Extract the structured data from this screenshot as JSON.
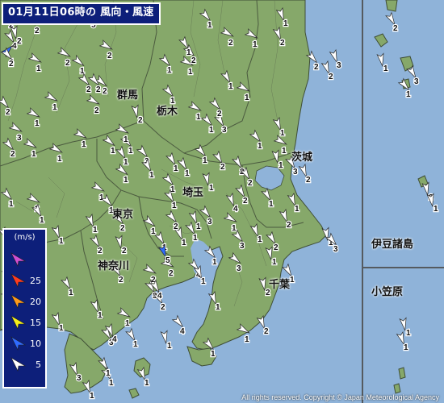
{
  "title": "01月11日06時の 風向・風速",
  "legend": {
    "unit": "(m/s)",
    "entries": [
      {
        "label": "",
        "color": "#d14dd1"
      },
      {
        "label": "25",
        "color": "#ff3b1f"
      },
      {
        "label": "20",
        "color": "#ff9a1a"
      },
      {
        "label": "15",
        "color": "#f5f01a"
      },
      {
        "label": "10",
        "color": "#2f6bff"
      },
      {
        "label": "5",
        "color": "#ffffff"
      }
    ]
  },
  "prefectures": [
    {
      "label": "群馬"
    },
    {
      "label": "栃木"
    },
    {
      "label": "茨城"
    },
    {
      "label": "埼玉"
    },
    {
      "label": "東京"
    },
    {
      "label": "神奈川"
    },
    {
      "label": "千葉"
    },
    {
      "label": "伊豆諸島"
    },
    {
      "label": "小笠原"
    }
  ],
  "copyright": "All rights reserved. Copyright © Japan Meteorological Agency",
  "colors": {
    "sea": "#8fb3d9",
    "land": "#86a86a",
    "boundary": "#4b5a3f",
    "panel": "#0d1f7a"
  },
  "stations": [
    {
      "speed": 2,
      "dir": 200,
      "color": "white"
    },
    {
      "speed": 2,
      "dir": 190,
      "color": "white"
    },
    {
      "speed": 4,
      "dir": 330,
      "color": "white"
    },
    {
      "speed": 4,
      "dir": 225,
      "color": "blue"
    },
    {
      "speed": 1,
      "dir": 300,
      "color": "white"
    },
    {
      "speed": 2,
      "dir": 300,
      "color": "white"
    },
    {
      "speed": 1,
      "dir": 310,
      "color": "white"
    },
    {
      "speed": 2,
      "dir": 300,
      "color": "white"
    },
    {
      "speed": 2,
      "dir": 320,
      "color": "white"
    },
    {
      "speed": 2,
      "dir": 310,
      "color": "white"
    },
    {
      "speed": 1,
      "dir": 300,
      "color": "white"
    },
    {
      "speed": 2,
      "dir": 320,
      "color": "white"
    },
    {
      "speed": 1,
      "dir": 300,
      "color": "white"
    },
    {
      "speed": 2,
      "dir": 300,
      "color": "white"
    },
    {
      "speed": 1,
      "dir": 300,
      "color": "white"
    },
    {
      "speed": 2,
      "dir": 320,
      "color": "white"
    },
    {
      "speed": 3,
      "dir": 300,
      "color": "white"
    },
    {
      "speed": 1,
      "dir": 300,
      "color": "white"
    },
    {
      "speed": 1,
      "dir": 310,
      "color": "white"
    },
    {
      "speed": 1,
      "dir": 320,
      "color": "white"
    },
    {
      "speed": 1,
      "dir": 300,
      "color": "white"
    },
    {
      "speed": 3,
      "dir": 320,
      "color": "white"
    },
    {
      "speed": 1,
      "dir": 300,
      "color": "white"
    },
    {
      "speed": 2,
      "dir": 320,
      "color": "white"
    },
    {
      "speed": 1,
      "dir": 300,
      "color": "white"
    },
    {
      "speed": 1,
      "dir": 320,
      "color": "white"
    },
    {
      "speed": 1,
      "dir": 300,
      "color": "white"
    },
    {
      "speed": 1,
      "dir": 320,
      "color": "white"
    },
    {
      "speed": 2,
      "dir": 320,
      "color": "white"
    },
    {
      "speed": 2,
      "dir": 300,
      "color": "white"
    },
    {
      "speed": 1,
      "dir": 300,
      "color": "white"
    },
    {
      "speed": 1,
      "dir": 330,
      "color": "white"
    },
    {
      "speed": 3,
      "dir": 330,
      "color": "white"
    },
    {
      "speed": 2,
      "dir": 330,
      "color": "white"
    },
    {
      "speed": 1,
      "dir": 320,
      "color": "white"
    },
    {
      "speed": 1,
      "dir": 340,
      "color": "white"
    },
    {
      "speed": 2,
      "dir": 340,
      "color": "white"
    },
    {
      "speed": 1,
      "dir": 320,
      "color": "white"
    },
    {
      "speed": 1,
      "dir": 300,
      "color": "white"
    },
    {
      "speed": 2,
      "dir": 320,
      "color": "white"
    },
    {
      "speed": 1,
      "dir": 330,
      "color": "white"
    },
    {
      "speed": 1,
      "dir": 320,
      "color": "white"
    },
    {
      "speed": 1,
      "dir": 330,
      "color": "white"
    },
    {
      "speed": 1,
      "dir": 310,
      "color": "white"
    },
    {
      "speed": 1,
      "dir": 300,
      "color": "white"
    },
    {
      "speed": 1,
      "dir": 320,
      "color": "white"
    },
    {
      "speed": 2,
      "dir": 300,
      "color": "white"
    },
    {
      "speed": 1,
      "dir": 320,
      "color": "white"
    },
    {
      "speed": 1,
      "dir": 330,
      "color": "white"
    },
    {
      "speed": 1,
      "dir": 340,
      "color": "white"
    },
    {
      "speed": 2,
      "dir": 330,
      "color": "white"
    },
    {
      "speed": 4,
      "dir": 320,
      "color": "white"
    },
    {
      "speed": 2,
      "dir": 300,
      "color": "white"
    },
    {
      "speed": 3,
      "dir": 310,
      "color": "white"
    },
    {
      "speed": 1,
      "dir": 330,
      "color": "white"
    },
    {
      "speed": 1,
      "dir": 340,
      "color": "white"
    },
    {
      "speed": 1,
      "dir": 320,
      "color": "white"
    },
    {
      "speed": 2,
      "dir": 300,
      "color": "white"
    },
    {
      "speed": 1,
      "dir": 330,
      "color": "white"
    },
    {
      "speed": 1,
      "dir": 310,
      "color": "white"
    },
    {
      "speed": 3,
      "dir": 330,
      "color": "white"
    },
    {
      "speed": 2,
      "dir": 320,
      "color": "white"
    },
    {
      "speed": 1,
      "dir": 340,
      "color": "white"
    },
    {
      "speed": 1,
      "dir": 300,
      "color": "white"
    },
    {
      "speed": 2,
      "dir": 330,
      "color": "white"
    },
    {
      "speed": 1,
      "dir": 330,
      "color": "white"
    },
    {
      "speed": 3,
      "dir": 320,
      "color": "white"
    },
    {
      "speed": 1,
      "dir": 340,
      "color": "white"
    },
    {
      "speed": 2,
      "dir": 330,
      "color": "white"
    },
    {
      "speed": 1,
      "dir": 350,
      "color": "white"
    },
    {
      "speed": 1,
      "dir": 340,
      "color": "white"
    },
    {
      "speed": 2,
      "dir": 340,
      "color": "white"
    },
    {
      "speed": 3,
      "dir": 320,
      "color": "white"
    },
    {
      "speed": 1,
      "dir": 330,
      "color": "white"
    },
    {
      "speed": 2,
      "dir": 330,
      "color": "white"
    },
    {
      "speed": 1,
      "dir": 300,
      "color": "white"
    },
    {
      "speed": 3,
      "dir": 330,
      "color": "white"
    },
    {
      "speed": 2,
      "dir": 340,
      "color": "white"
    },
    {
      "speed": 1,
      "dir": 350,
      "color": "white"
    },
    {
      "speed": 3,
      "dir": 340,
      "color": "white"
    },
    {
      "speed": 2,
      "dir": 340,
      "color": "white"
    },
    {
      "speed": 1,
      "dir": 320,
      "color": "white"
    },
    {
      "speed": 1,
      "dir": 330,
      "color": "white"
    },
    {
      "speed": 2,
      "dir": 320,
      "color": "white"
    },
    {
      "speed": 1,
      "dir": 340,
      "color": "white"
    },
    {
      "speed": 1,
      "dir": 350,
      "color": "white"
    },
    {
      "speed": 2,
      "dir": 330,
      "color": "white"
    },
    {
      "speed": 1,
      "dir": 320,
      "color": "white"
    },
    {
      "speed": 1,
      "dir": 330,
      "color": "white"
    },
    {
      "speed": 2,
      "dir": 350,
      "color": "white"
    },
    {
      "speed": 2,
      "dir": 350,
      "color": "white"
    },
    {
      "speed": 2,
      "dir": 340,
      "color": "white"
    },
    {
      "speed": 4,
      "dir": 330,
      "color": "white"
    },
    {
      "speed": 1,
      "dir": 340,
      "color": "white"
    },
    {
      "speed": 1,
      "dir": 300,
      "color": "white"
    },
    {
      "speed": 2,
      "dir": 330,
      "color": "white"
    },
    {
      "speed": 4,
      "dir": 320,
      "color": "white"
    },
    {
      "speed": 1,
      "dir": 340,
      "color": "white"
    },
    {
      "speed": 2,
      "dir": 340,
      "color": "white"
    },
    {
      "speed": 1,
      "dir": 300,
      "color": "white"
    },
    {
      "speed": 1,
      "dir": 320,
      "color": "white"
    },
    {
      "speed": 1,
      "dir": 330,
      "color": "white"
    },
    {
      "speed": 1,
      "dir": 340,
      "color": "white"
    },
    {
      "speed": 3,
      "dir": 330,
      "color": "white"
    },
    {
      "speed": 2,
      "dir": 320,
      "color": "white"
    },
    {
      "speed": 5,
      "dir": 340,
      "color": "blue"
    },
    {
      "speed": 4,
      "dir": 340,
      "color": "white"
    },
    {
      "speed": 1,
      "dir": 350,
      "color": "white"
    },
    {
      "speed": 1,
      "dir": 330,
      "color": "white"
    },
    {
      "speed": 1,
      "dir": 340,
      "color": "white"
    },
    {
      "speed": 4,
      "dir": 330,
      "color": "white"
    },
    {
      "speed": 2,
      "dir": 330,
      "color": "white"
    },
    {
      "speed": 1,
      "dir": 330,
      "color": "white"
    },
    {
      "speed": 1,
      "dir": 340,
      "color": "white"
    },
    {
      "speed": 1,
      "dir": 350,
      "color": "white"
    },
    {
      "speed": 1,
      "dir": 330,
      "color": "white"
    },
    {
      "speed": 1,
      "dir": 340,
      "color": "white"
    },
    {
      "speed": 4,
      "dir": 340,
      "color": "white"
    },
    {
      "speed": 1,
      "dir": 330,
      "color": "white"
    },
    {
      "speed": 1,
      "dir": 340,
      "color": "white"
    },
    {
      "speed": 3,
      "dir": 340,
      "color": "white"
    },
    {
      "speed": 1,
      "dir": 340,
      "color": "white"
    },
    {
      "speed": 3,
      "dir": 300,
      "color": "white"
    },
    {
      "speed": 1,
      "dir": 320,
      "color": "white"
    },
    {
      "speed": 1,
      "dir": 330,
      "color": "white"
    },
    {
      "speed": 3,
      "dir": 320,
      "color": "white"
    },
    {
      "speed": 2,
      "dir": 330,
      "color": "white"
    },
    {
      "speed": 1,
      "dir": 350,
      "color": "white"
    },
    {
      "speed": 3,
      "dir": 330,
      "color": "white"
    },
    {
      "speed": 1,
      "dir": 320,
      "color": "white"
    },
    {
      "speed": 2,
      "dir": 350,
      "color": "white"
    },
    {
      "speed": 1,
      "dir": 350,
      "color": "white"
    },
    {
      "speed": 1,
      "dir": 350,
      "color": "white"
    },
    {
      "speed": 1,
      "dir": 340,
      "color": "white"
    },
    {
      "speed": 1,
      "dir": 330,
      "color": "white"
    },
    {
      "speed": 2,
      "dir": 350,
      "color": "white"
    },
    {
      "speed": 3,
      "dir": 320,
      "color": "white"
    },
    {
      "speed": 2,
      "dir": 320,
      "color": "white"
    },
    {
      "speed": 2,
      "dir": 350,
      "color": "white"
    },
    {
      "speed": 5,
      "dir": 340,
      "color": "blue"
    },
    {
      "speed": 4,
      "dir": 340,
      "color": "white"
    },
    {
      "speed": 1,
      "dir": 320,
      "color": "white"
    },
    {
      "speed": 1,
      "dir": 320,
      "color": "white"
    },
    {
      "speed": 1,
      "dir": 330,
      "color": "white"
    }
  ]
}
